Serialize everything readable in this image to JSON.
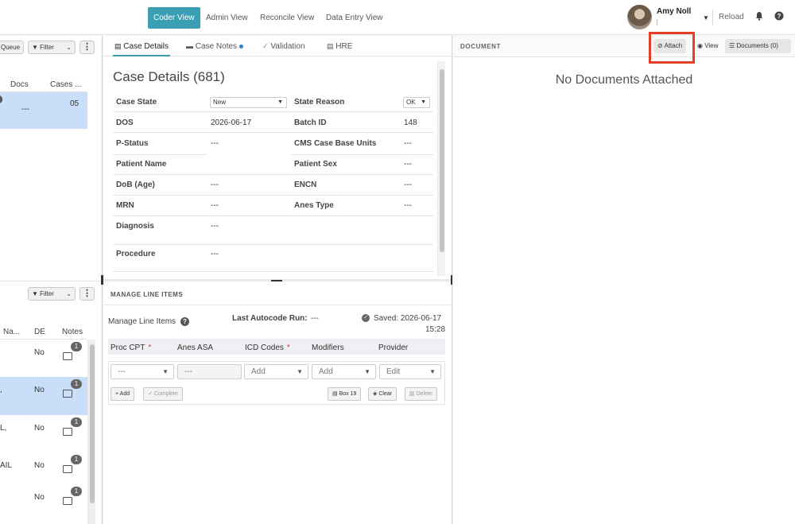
{
  "topnav": {
    "tabs": [
      {
        "label": "Coder View",
        "active": true
      },
      {
        "label": "Admin View",
        "active": false
      },
      {
        "label": "Reconcile View",
        "active": false
      },
      {
        "label": "Data Entry View",
        "active": false
      }
    ],
    "user_name": "Amy Noll",
    "reload_label": "Reload",
    "accent": "#3a9fb5"
  },
  "left_top": {
    "queue_label": "Queue",
    "filter_label": "Filter",
    "columns": [
      "Docs",
      "Cases ..."
    ],
    "row": {
      "docs": "---",
      "cases": "05"
    }
  },
  "left_bottom": {
    "filter_label": "Filter",
    "columns": [
      "Na...",
      "DE",
      "Notes"
    ],
    "rows": [
      {
        "name": "",
        "de": "No",
        "notes": "1"
      },
      {
        "name": ",",
        "de": "No",
        "notes": "1"
      },
      {
        "name": "L,",
        "de": "No",
        "notes": "1"
      },
      {
        "name": "AIL",
        "de": "No",
        "notes": "1"
      },
      {
        "name": "",
        "de": "No",
        "notes": "1"
      }
    ]
  },
  "case_tabs": [
    {
      "label": "Case Details",
      "active": true
    },
    {
      "label": "Case Notes",
      "active": false
    },
    {
      "label": "Validation",
      "active": false
    },
    {
      "label": "HRE",
      "active": false
    }
  ],
  "case_details": {
    "title": "Case Details (681)",
    "case_state_label": "Case State",
    "case_state_value": "New",
    "state_reason_label": "State Reason",
    "state_reason_value": "OK",
    "dos_label": "DOS",
    "dos_value": "2026-06-17",
    "batch_id_label": "Batch ID",
    "batch_id_value": "148",
    "pstatus_label": "P-Status",
    "pstatus_value": "---",
    "cms_label": "CMS Case Base Units",
    "cms_value": "---",
    "patient_name_label": "Patient Name",
    "patient_sex_label": "Patient Sex",
    "patient_sex_value": "---",
    "dob_label": "DoB (Age)",
    "dob_value": "---",
    "encn_label": "ENCN",
    "encn_value": "---",
    "mrn_label": "MRN",
    "mrn_value": "---",
    "anes_type_label": "Anes Type",
    "anes_type_value": "---",
    "diagnosis_label": "Diagnosis",
    "diagnosis_value": "---",
    "procedure_label": "Procedure",
    "procedure_value": "---"
  },
  "line_items": {
    "section_title": "MANAGE LINE ITEMS",
    "manage_label": "Manage Line Items",
    "last_autocode_label": "Last Autocode Run:",
    "last_autocode_value": "---",
    "saved_label": "Saved: 2026-06-17",
    "saved_time": "15:28",
    "headers": [
      "Proc CPT",
      "Anes ASA",
      "ICD Codes",
      "Modifiers",
      "Provider"
    ],
    "required_mark": "*",
    "inputs": {
      "proc_cpt": "---",
      "anes_asa": "---",
      "icd": "Add",
      "modifiers": "Add",
      "provider": "Edit"
    },
    "buttons": {
      "add": "Add",
      "complete": "Complete",
      "box19": "Box 19",
      "clear": "Clear",
      "delete": "Delete"
    }
  },
  "document": {
    "label": "DOCUMENT",
    "attach_label": "Attach",
    "view_label": "View",
    "documents_label": "Documents (0)",
    "empty_text": "No Documents Attached"
  }
}
